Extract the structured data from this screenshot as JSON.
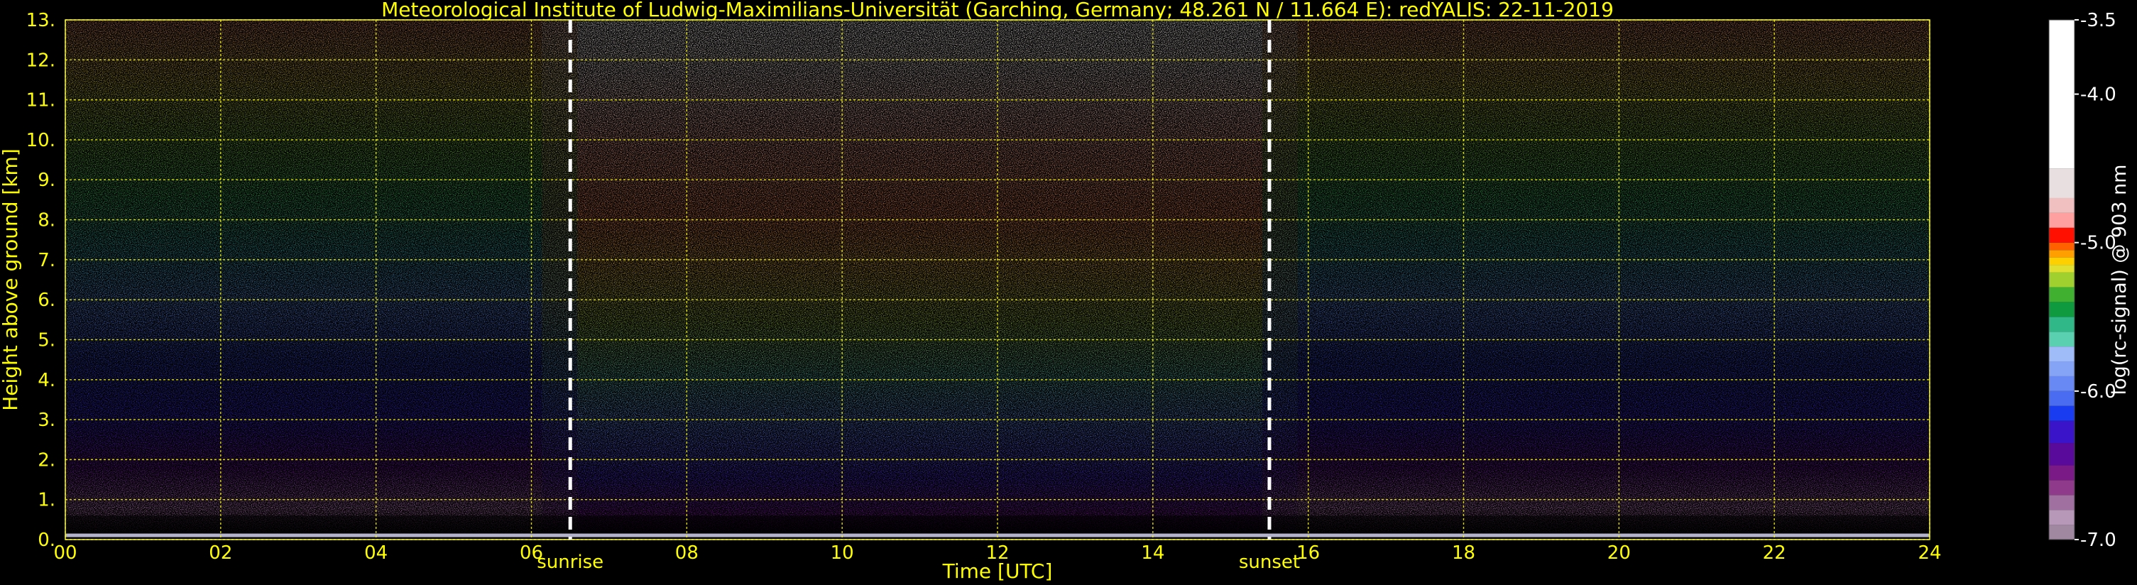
{
  "chart_data": {
    "type": "heatmap",
    "title": "Meteorological Institute of Ludwig-Maximilians-Universität (Garching, Germany; 48.261 N / 11.664 E):    redYALIS: 22-11-2019",
    "xlabel": "Time [UTC]",
    "ylabel": "Height above ground [km]",
    "xlim": [
      0,
      24
    ],
    "ylim": [
      0,
      13
    ],
    "x_ticks": [
      "00",
      "02",
      "04",
      "06",
      "08",
      "10",
      "12",
      "14",
      "16",
      "18",
      "20",
      "22",
      "24"
    ],
    "x_tick_values": [
      0,
      2,
      4,
      6,
      8,
      10,
      12,
      14,
      16,
      18,
      20,
      22,
      24
    ],
    "y_ticks": [
      "0.",
      "1.",
      "2.",
      "3.",
      "4.",
      "5.",
      "6.",
      "7.",
      "8.",
      "9.",
      "10.",
      "11.",
      "12.",
      "13."
    ],
    "y_tick_values": [
      0,
      1,
      2,
      3,
      4,
      5,
      6,
      7,
      8,
      9,
      10,
      11,
      12,
      13
    ],
    "grid": true,
    "events": [
      {
        "label": "sunrise",
        "time": 6.5
      },
      {
        "label": "sunset",
        "time": 15.5
      }
    ],
    "colorbar": {
      "label": "log(rc-signal) @ 903 nm",
      "range": [
        -7.0,
        -3.5
      ],
      "ticks": [
        "-3.5",
        "-4.0",
        "-5.0",
        "-6.0",
        "-7.0"
      ],
      "tick_values": [
        -3.5,
        -4.0,
        -5.0,
        -6.0,
        -7.0
      ],
      "colors": [
        "#a088a0",
        "#b898b8",
        "#a070a0",
        "#903a8c",
        "#7a1a86",
        "#5a0a9a",
        "#3a14c8",
        "#1a3cf0",
        "#4a6cf0",
        "#6888f4",
        "#86a4f6",
        "#a0bcf8",
        "#5ad0b0",
        "#30b888",
        "#109a40",
        "#40b030",
        "#a0d030",
        "#e0e030",
        "#ffd000",
        "#ffa000",
        "#ff6000",
        "#ff1000",
        "#ffa0a0",
        "#f0c0c0",
        "#e8e0e0",
        "#ffffff"
      ],
      "color_positions": [
        -7.0,
        -6.9,
        -6.8,
        -6.7,
        -6.6,
        -6.5,
        -6.35,
        -6.2,
        -6.1,
        -6.0,
        -5.9,
        -5.8,
        -5.7,
        -5.6,
        -5.5,
        -5.4,
        -5.3,
        -5.2,
        -5.15,
        -5.1,
        -5.05,
        -5.0,
        -4.9,
        -4.8,
        -4.7,
        -4.5
      ]
    }
  }
}
